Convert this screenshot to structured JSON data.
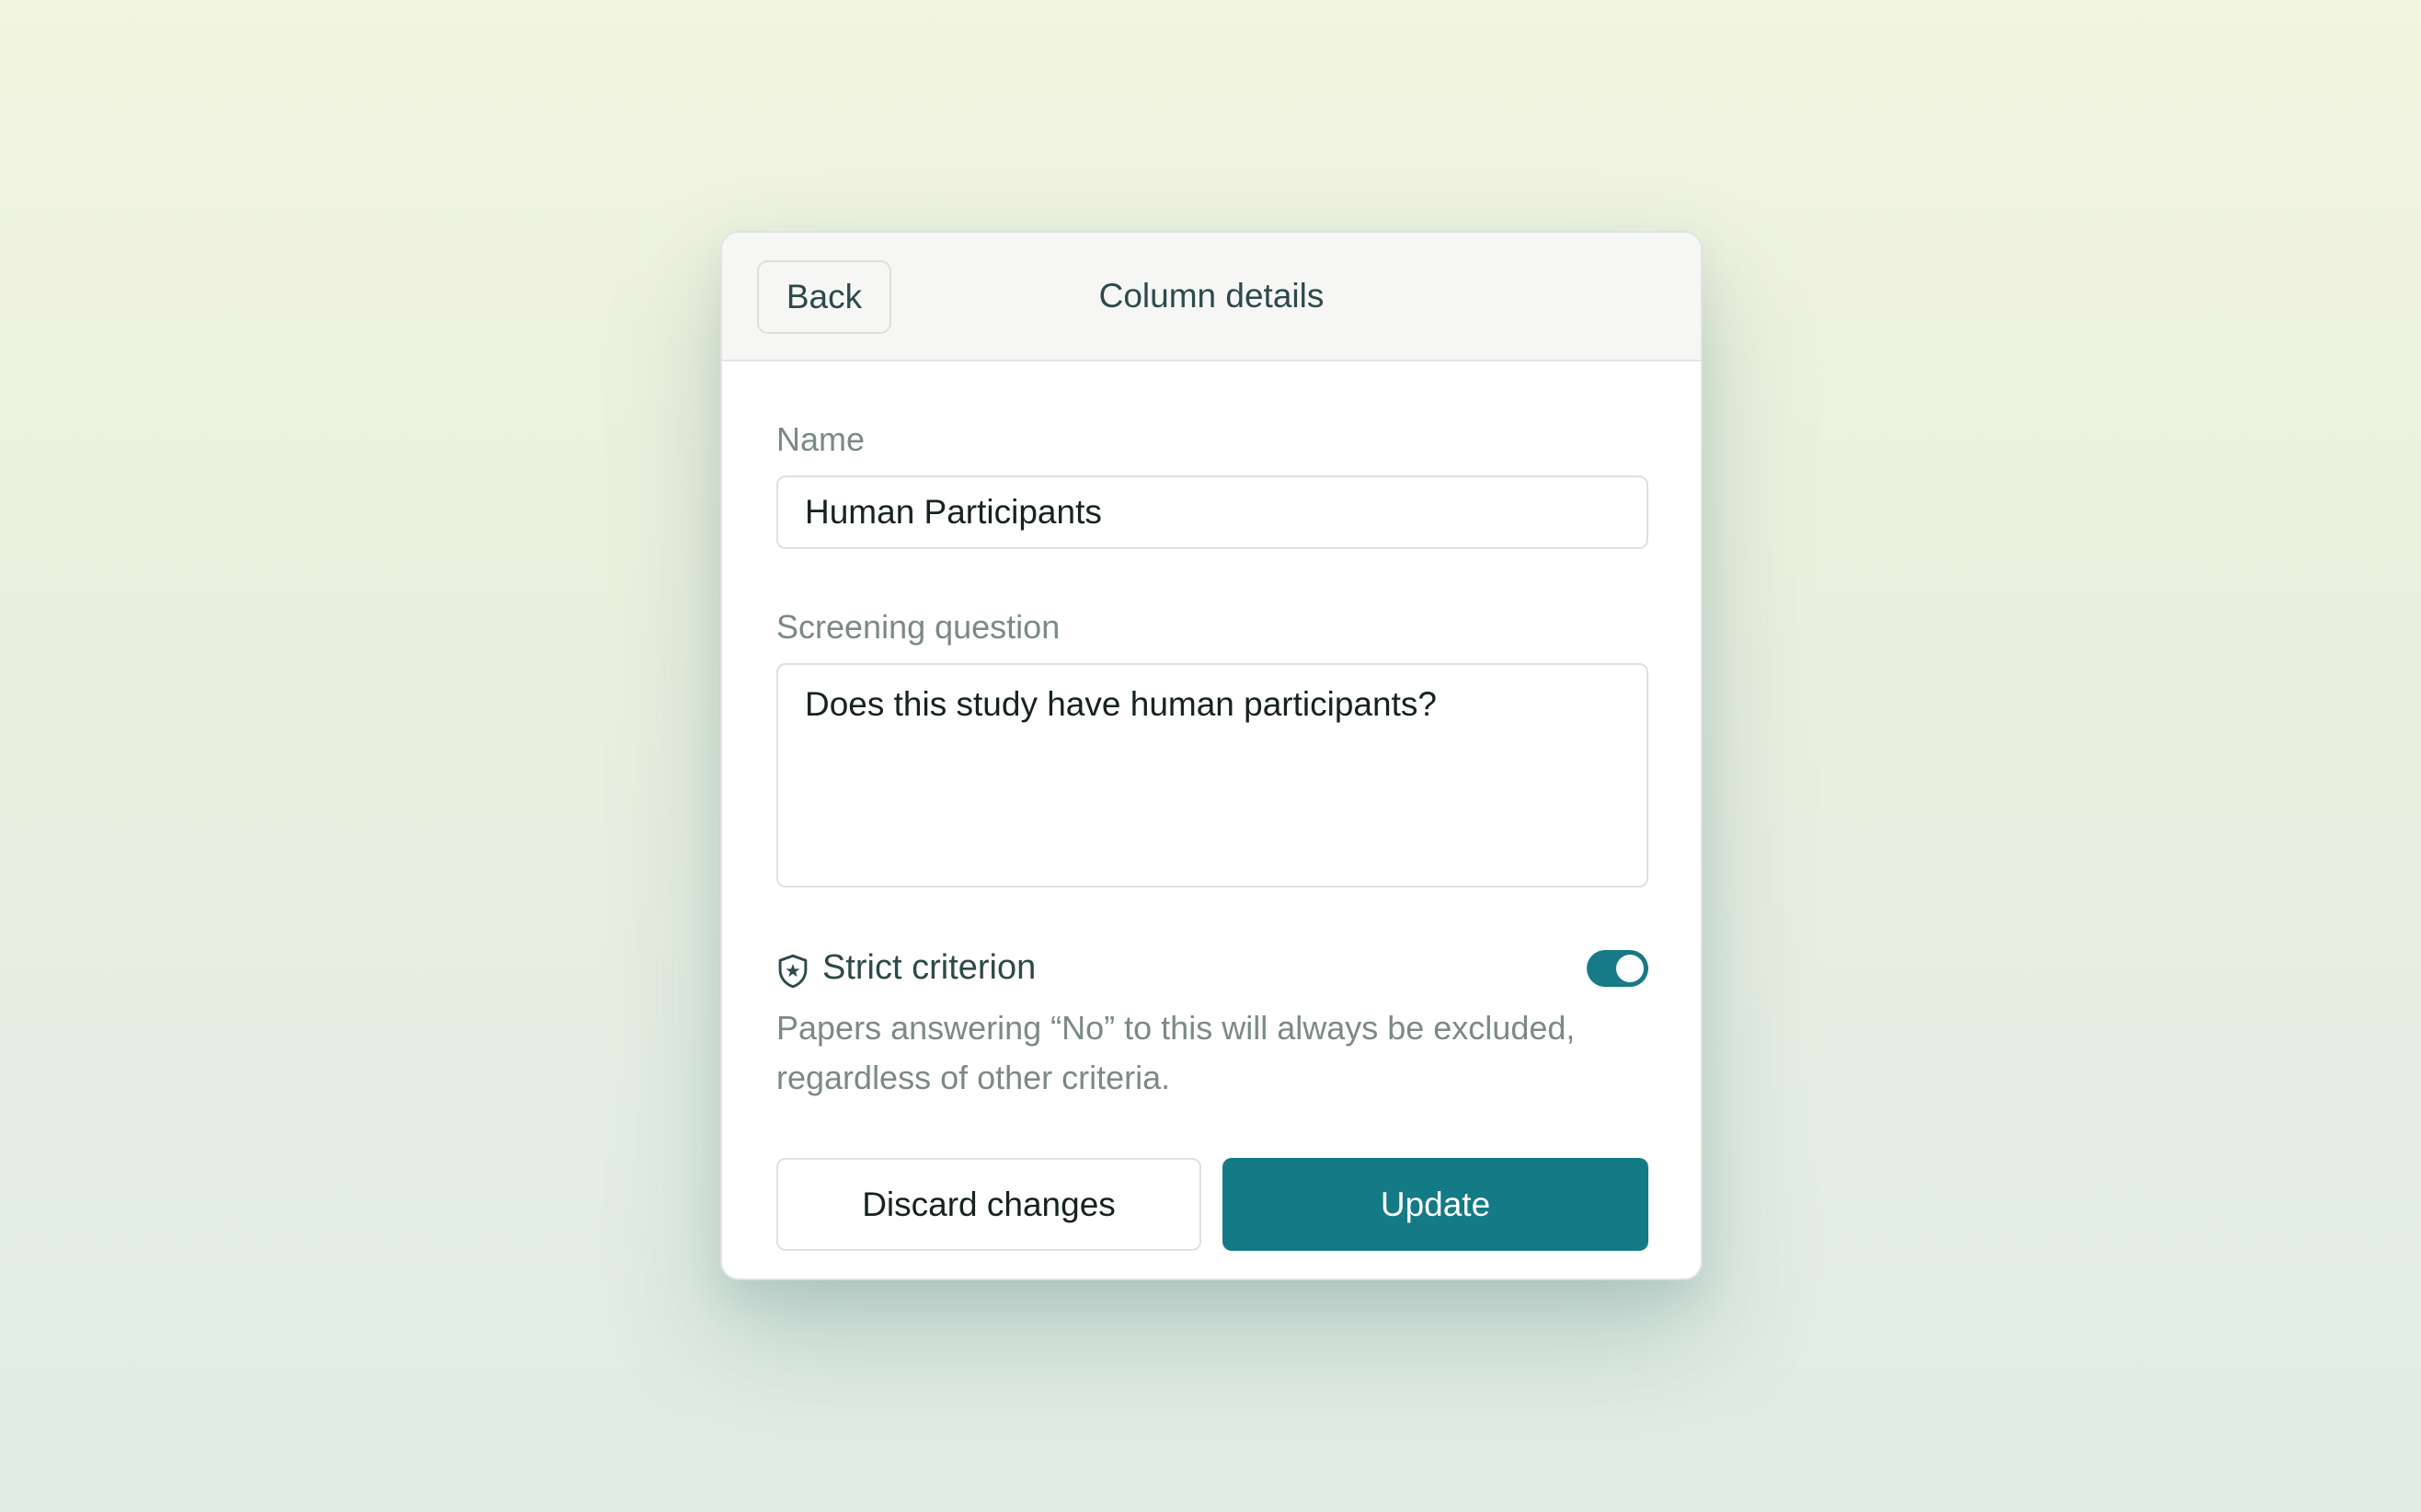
{
  "header": {
    "back_label": "Back",
    "title": "Column details"
  },
  "form": {
    "name_label": "Name",
    "name_value": "Human Participants",
    "question_label": "Screening question",
    "question_value": "Does this study have human participants?"
  },
  "strict": {
    "icon": "shield-star-icon",
    "label": "Strict criterion",
    "enabled": true,
    "description": "Papers answering “No” to this will always be excluded, regardless of other criteria."
  },
  "actions": {
    "discard_label": "Discard changes",
    "update_label": "Update"
  },
  "colors": {
    "accent": "#147a86",
    "text_primary": "#16231f",
    "text_muted": "#7b8a86",
    "header_bg": "#f6f7f5"
  }
}
